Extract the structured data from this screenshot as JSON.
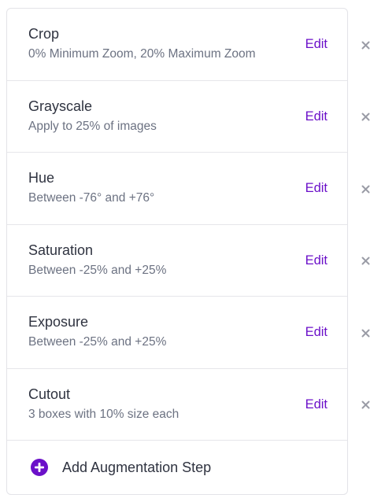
{
  "steps": [
    {
      "title": "Crop",
      "description": "0% Minimum Zoom, 20% Maximum Zoom",
      "edit_label": "Edit"
    },
    {
      "title": "Grayscale",
      "description": "Apply to 25% of images",
      "edit_label": "Edit"
    },
    {
      "title": "Hue",
      "description": "Between -76° and +76°",
      "edit_label": "Edit"
    },
    {
      "title": "Saturation",
      "description": "Between -25% and +25%",
      "edit_label": "Edit"
    },
    {
      "title": "Exposure",
      "description": "Between -25% and +25%",
      "edit_label": "Edit"
    },
    {
      "title": "Cutout",
      "description": "3 boxes with 10% size each",
      "edit_label": "Edit"
    }
  ],
  "add_step": {
    "label": "Add Augmentation Step",
    "icon": "plus-circle-icon"
  },
  "remove_icon": "close-icon",
  "colors": {
    "accent": "#6b10c9",
    "title": "#2f3340",
    "description": "#6c7282",
    "remove": "#9a9ca6"
  }
}
